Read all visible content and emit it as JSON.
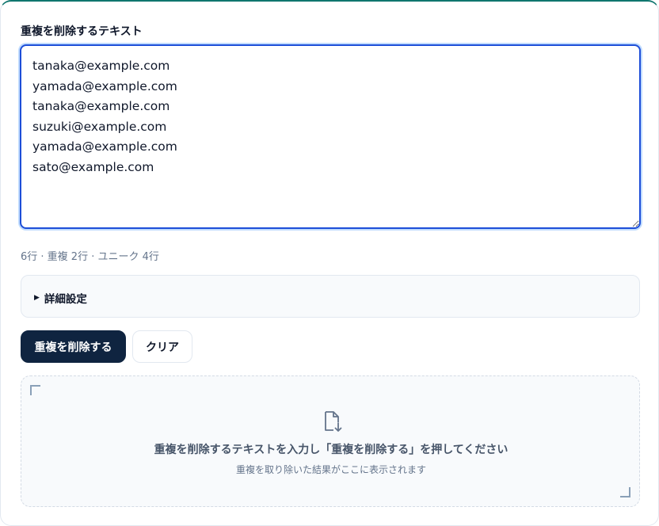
{
  "form": {
    "label": "重複を削除するテキスト",
    "textarea_value": "tanaka@example.com\nyamada@example.com\ntanaka@example.com\nsuzuki@example.com\nyamada@example.com\nsato@example.com",
    "stats": "6行 · 重複 2行 · ユニーク 4行"
  },
  "details": {
    "caret": "▶",
    "summary": "詳細設定"
  },
  "actions": {
    "dedupe_label": "重複を削除する",
    "clear_label": "クリア"
  },
  "result": {
    "icon": "file-download-icon",
    "title": "重複を削除するテキストを入力し「重複を削除する」を押してください",
    "subtitle": "重複を取り除いた結果がここに表示されます"
  },
  "colors": {
    "accent": "#0f766e",
    "primary_button": "#0f2440",
    "focus_border": "#1d4ed8"
  }
}
